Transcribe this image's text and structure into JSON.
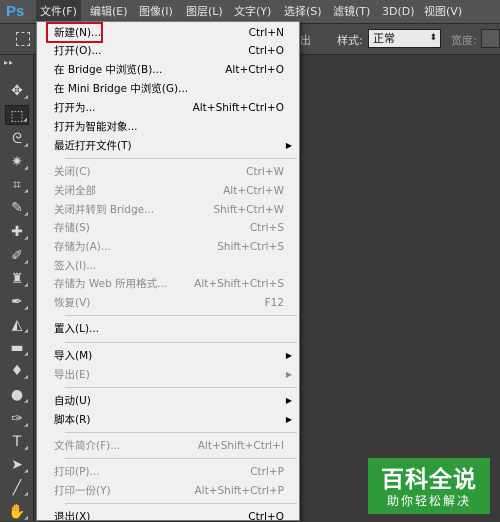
{
  "app": {
    "logo": "Ps"
  },
  "menubar": {
    "items": [
      {
        "label": "文件(F)"
      },
      {
        "label": "编辑(E)"
      },
      {
        "label": "图像(I)"
      },
      {
        "label": "图层(L)"
      },
      {
        "label": "文字(Y)"
      },
      {
        "label": "选择(S)"
      },
      {
        "label": "滤镜(T)"
      },
      {
        "label": "3D(D)"
      },
      {
        "label": "视图(V)"
      }
    ]
  },
  "options_bar": {
    "clipped_text": "出",
    "style_label": "样式:",
    "style_value": "正常",
    "width_label": "宽度:"
  },
  "file_menu": {
    "items": [
      {
        "label": "新建(N)...",
        "shortcut": "Ctrl+N"
      },
      {
        "label": "打开(O)...",
        "shortcut": "Ctrl+O"
      },
      {
        "label": "在 Bridge 中浏览(B)...",
        "shortcut": "Alt+Ctrl+O"
      },
      {
        "label": "在 Mini Bridge 中浏览(G)...",
        "shortcut": ""
      },
      {
        "label": "打开为...",
        "shortcut": "Alt+Shift+Ctrl+O"
      },
      {
        "label": "打开为智能对象...",
        "shortcut": ""
      },
      {
        "label": "最近打开文件(T)",
        "shortcut": ""
      },
      {
        "label": "关闭(C)",
        "shortcut": "Ctrl+W"
      },
      {
        "label": "关闭全部",
        "shortcut": "Alt+Ctrl+W"
      },
      {
        "label": "关闭并转到 Bridge...",
        "shortcut": "Shift+Ctrl+W"
      },
      {
        "label": "存储(S)",
        "shortcut": "Ctrl+S"
      },
      {
        "label": "存储为(A)...",
        "shortcut": "Shift+Ctrl+S"
      },
      {
        "label": "签入(I)...",
        "shortcut": ""
      },
      {
        "label": "存储为 Web 所用格式...",
        "shortcut": "Alt+Shift+Ctrl+S"
      },
      {
        "label": "恢复(V)",
        "shortcut": "F12"
      },
      {
        "label": "置入(L)...",
        "shortcut": ""
      },
      {
        "label": "导入(M)",
        "shortcut": ""
      },
      {
        "label": "导出(E)",
        "shortcut": ""
      },
      {
        "label": "自动(U)",
        "shortcut": ""
      },
      {
        "label": "脚本(R)",
        "shortcut": ""
      },
      {
        "label": "文件简介(F)...",
        "shortcut": "Alt+Shift+Ctrl+I"
      },
      {
        "label": "打印(P)...",
        "shortcut": "Ctrl+P"
      },
      {
        "label": "打印一份(Y)",
        "shortcut": "Alt+Shift+Ctrl+P"
      },
      {
        "label": "退出(X)",
        "shortcut": "Ctrl+Q"
      }
    ]
  },
  "watermark": {
    "title": "百科全说",
    "subtitle": "助你轻松解决"
  },
  "colors": {
    "highlight_box": "#c8101c",
    "watermark_bg": "#2e9b3a"
  }
}
